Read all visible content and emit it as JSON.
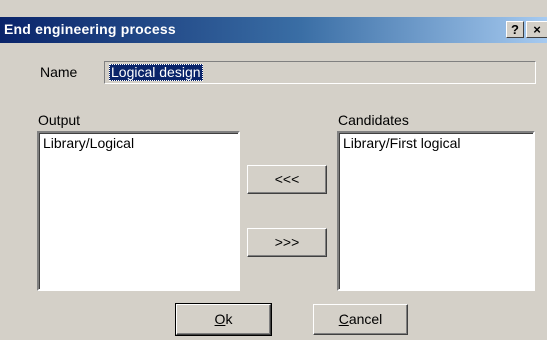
{
  "window": {
    "title": "End engineering process",
    "help_label": "?",
    "close_label": "×"
  },
  "name": {
    "label": "Name",
    "value": "Logical design"
  },
  "output": {
    "label": "Output",
    "items": [
      "Library/Logical"
    ]
  },
  "candidates": {
    "label": "Candidates",
    "items": [
      "Library/First logical"
    ]
  },
  "transfer": {
    "to_output_label": "<<<",
    "to_candidates_label": ">>>"
  },
  "buttons": {
    "ok_mnemonic": "O",
    "ok_rest": "k",
    "cancel_mnemonic": "C",
    "cancel_rest": "ancel"
  }
}
